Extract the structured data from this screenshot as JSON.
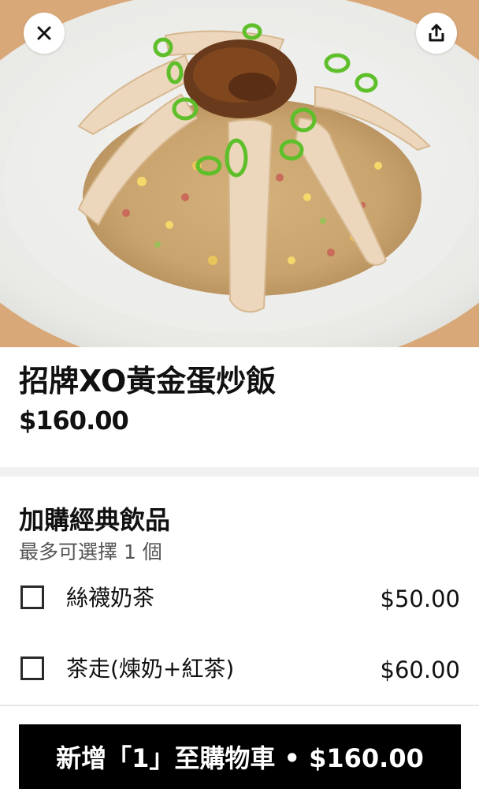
{
  "item": {
    "title": "招牌XO黃金蛋炒飯",
    "price": "$160.00"
  },
  "hero": {
    "close_icon": "close-icon",
    "share_icon": "share-icon"
  },
  "option_group": {
    "title": "加購經典飲品",
    "subtitle": "最多可選擇 1 個",
    "options": [
      {
        "label": "絲襪奶茶",
        "price": "$50.00",
        "checked": false
      },
      {
        "label": "茶走(煉奶+紅茶)",
        "price": "$60.00",
        "checked": false
      }
    ]
  },
  "cta": {
    "label": "新增「1」至購物車 • $160.00"
  },
  "colors": {
    "cta_background": "#000000",
    "cta_text": "#ffffff",
    "divider": "#f1f1f1",
    "subtitle": "#545454"
  }
}
